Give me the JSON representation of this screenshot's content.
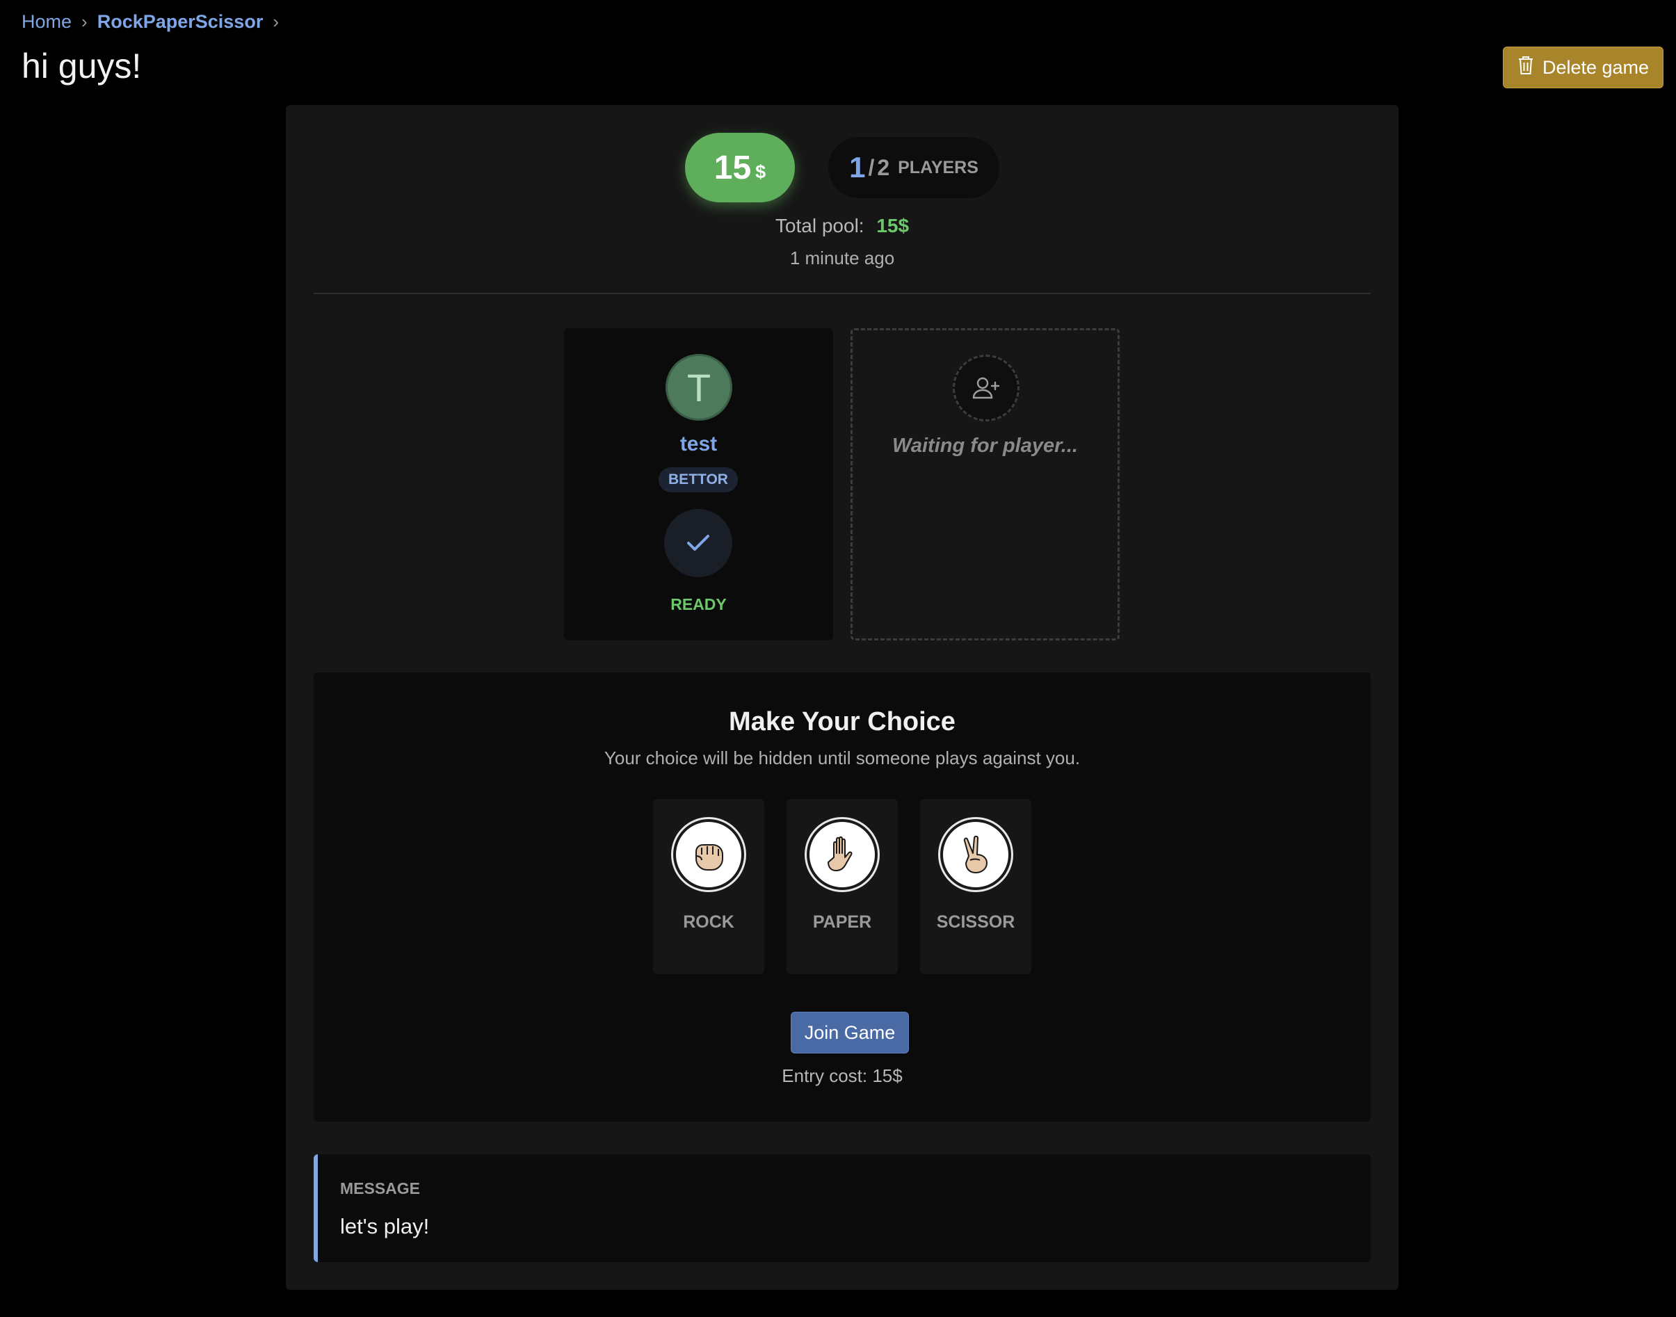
{
  "breadcrumb": {
    "home": "Home",
    "current": "RockPaperScissor",
    "separator": "›"
  },
  "page": {
    "title": "hi guys!"
  },
  "header": {
    "delete_label": "Delete game",
    "delete_icon": "trash-icon"
  },
  "stats": {
    "bet_amount": "15",
    "bet_currency": "$",
    "players_count": "1",
    "players_separator": "/",
    "players_max": "2",
    "players_label": "PLAYERS",
    "pool_label": "Total pool:",
    "pool_value": "15$",
    "time_ago": "1 minute ago"
  },
  "player": {
    "initial": "T",
    "name": "test",
    "role": "BETTOR",
    "status": "READY"
  },
  "empty_slot": {
    "text": "Waiting for player..."
  },
  "choice": {
    "title": "Make Your Choice",
    "subtitle": "Your choice will be hidden until someone plays against you.",
    "options": [
      {
        "label": "ROCK",
        "icon": "rock-hand-icon"
      },
      {
        "label": "PAPER",
        "icon": "paper-hand-icon"
      },
      {
        "label": "SCISSOR",
        "icon": "scissor-hand-icon"
      }
    ],
    "join_label": "Join Game",
    "entry_text": "Entry cost: 15$"
  },
  "message": {
    "title": "MESSAGE",
    "body": "let's play!"
  },
  "colors": {
    "accent_blue": "#7fa7e8",
    "success_green": "#6cc96a",
    "delete_gold": "#a8842a",
    "join_blue": "#4a6aa6"
  }
}
